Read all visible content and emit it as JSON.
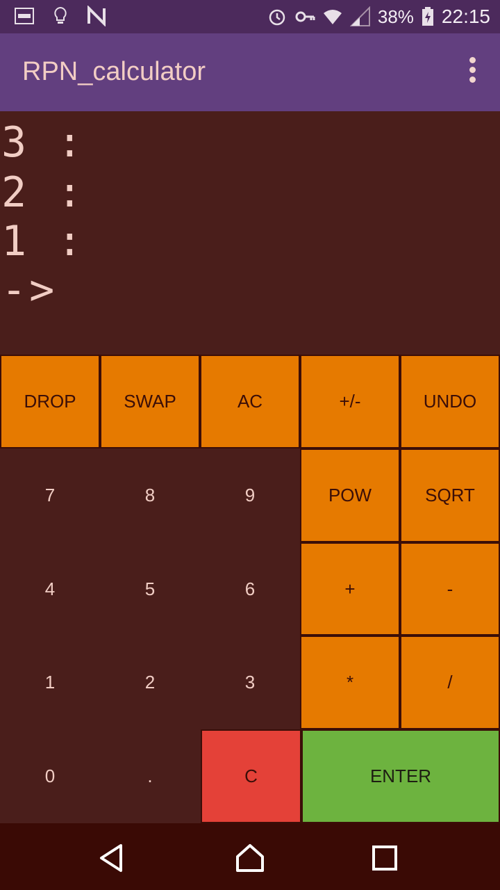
{
  "status_bar": {
    "battery": "38%",
    "time": "22:15",
    "left_icons": [
      "screenshot-icon",
      "lightbulb-icon",
      "n-logo-icon"
    ],
    "right_icons": [
      "alarm-icon",
      "vpn-key-icon",
      "wifi-icon",
      "signal-icon",
      "battery-charging-icon"
    ]
  },
  "app_bar": {
    "title": "RPN_calculator",
    "menu_icon": "more-vertical-icon"
  },
  "stack": {
    "lines": [
      "3 :",
      "2 :",
      "1 :",
      "->"
    ]
  },
  "keypad": {
    "rows": [
      [
        "DROP",
        "SWAP",
        "AC",
        "+/-",
        "UNDO"
      ],
      [
        "7",
        "8",
        "9",
        "POW",
        "SQRT"
      ],
      [
        "4",
        "5",
        "6",
        "+",
        "-"
      ],
      [
        "1",
        "2",
        "3",
        "*",
        "/"
      ],
      [
        "0",
        ".",
        "C",
        "ENTER"
      ]
    ]
  },
  "nav_bar": {
    "icons": [
      "back-icon",
      "home-icon",
      "recents-icon"
    ]
  },
  "colors": {
    "status_bar": "#4c2a5c",
    "app_bar": "#623f7f",
    "background": "#4a1e1b",
    "op_key": "#e67a00",
    "clear_key": "#e44138",
    "enter_key": "#6db33f",
    "nav_bar": "#3a0a05"
  }
}
